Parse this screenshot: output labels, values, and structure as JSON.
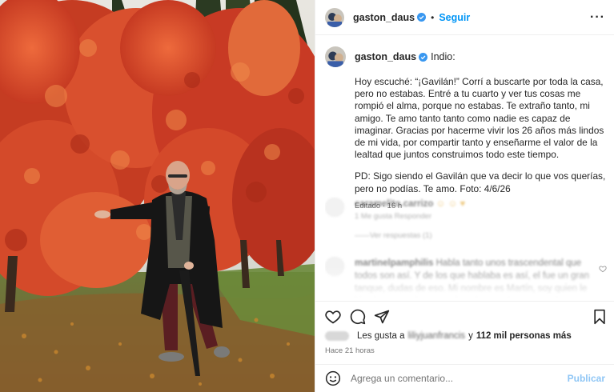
{
  "post": {
    "username": "gaston_daus",
    "follow_label": "Seguir",
    "more_label": "···",
    "caption_title": "Indio:",
    "caption_paragraphs": [
      "Hoy escuché: “¡Gavilán!” Corrí a buscarte por toda la casa, pero no estabas. Entré a tu cuarto y ver tus cosas me rompió el alma, porque no estabas. Te extraño tanto, mi amigo. Te amo tanto tanto como nadie es capaz de imaginar. Gracias por hacerme vivir los 26 años más lindos de mi vida, por compartir tanto y enseñarme el valor de la lealtad que juntos construimos todo este tiempo.",
      "PD: Sigo siendo el Gavilán que va decir lo que vos querías, pero no podías. Te amo. Foto: 4/6/26"
    ],
    "edited_label": "Editado · 16 h"
  },
  "comments": [
    {
      "username": "caramelito.carrizo",
      "text": "",
      "meta": "1 Me gusta  Responder",
      "replies": "Ver respuestas (1)"
    },
    {
      "username": "martinelpamphilis",
      "text": "Habla tanto unos trascendental que todos son así. Y de los que hablaba es así, el fue un gran tanque, dudas de eso. Mi nombre es Martín, soy quien le hizo la correa de cuero clavada con plumas para la guitarra. Su A",
      "meta": ""
    }
  ],
  "likes": {
    "prefix": "Les gusta a",
    "name": "liliyjuanfrancis",
    "suffix": "y",
    "count_label": "112 mil personas más"
  },
  "time_label": "Hace 21 horas",
  "comment_box": {
    "placeholder": "Agrega un comentario...",
    "post_label": "Publicar"
  },
  "icons": {
    "verified": "verified-badge-icon",
    "like": "heart-icon",
    "comment": "comment-icon",
    "share": "share-icon",
    "save": "bookmark-icon",
    "emoji": "emoji-icon"
  },
  "colors": {
    "accent": "#0095f6",
    "verified": "#3897f0",
    "publish_disabled": "#8fc6f5",
    "leaves": "#d8442a"
  }
}
